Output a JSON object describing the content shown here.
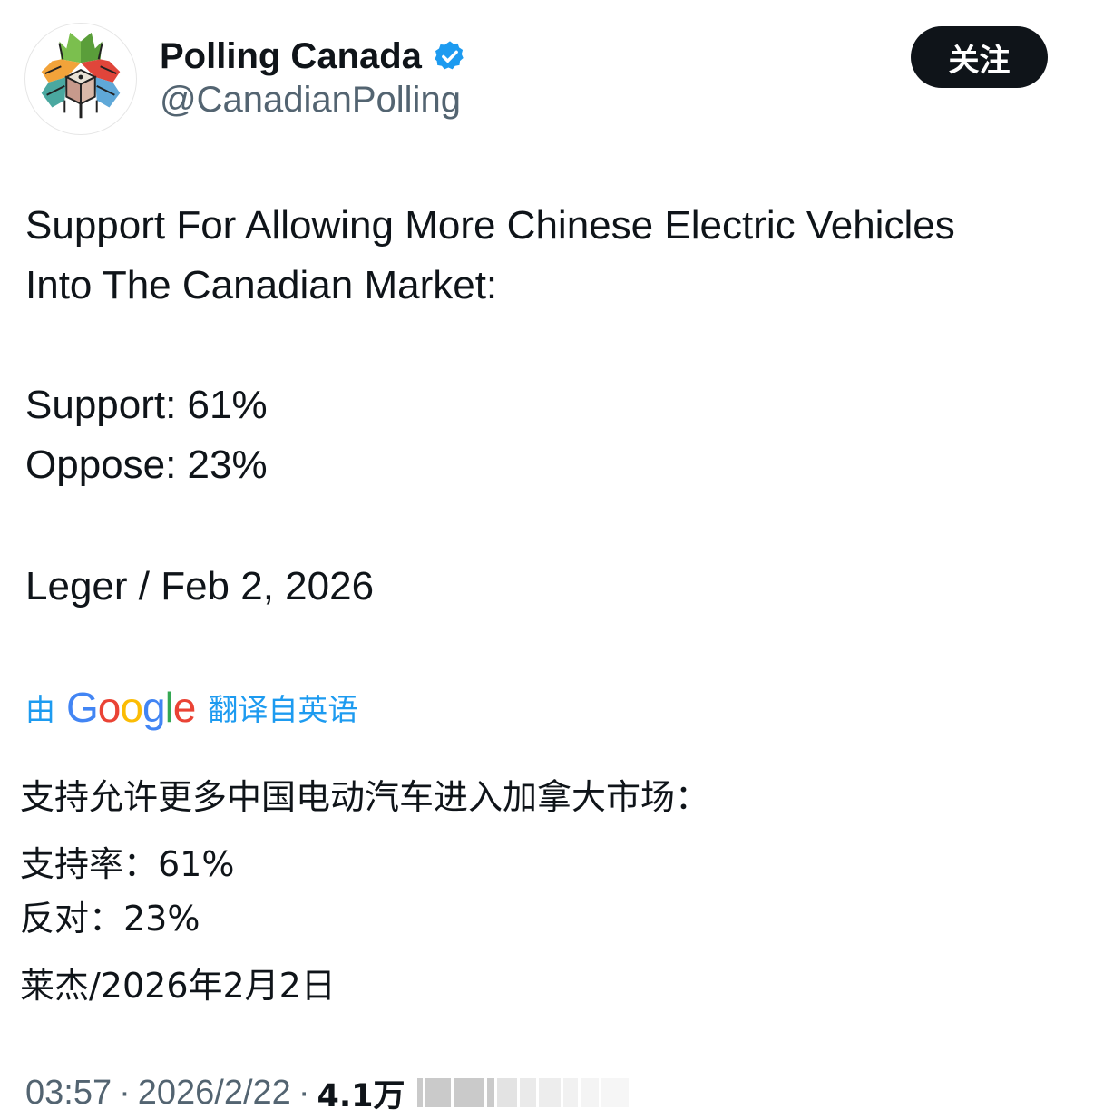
{
  "author": {
    "display_name": "Polling Canada",
    "handle": "@CanadianPolling",
    "verified": true,
    "avatar_icon": "maple-leaf-logo-icon",
    "verified_icon": "verified-badge-icon",
    "verified_color": "#1d9bf0"
  },
  "follow_button": {
    "label": "关注"
  },
  "tweet": {
    "title_line1": "Support For Allowing More Chinese Electric Vehicles",
    "title_line2": "Into The Canadian Market:",
    "support_line": "Support: 61%",
    "oppose_line": "Oppose: 23%",
    "source_line": "Leger / Feb 2, 2026"
  },
  "translation": {
    "prefix": "由",
    "provider": "Google",
    "suffix": "翻译自英语",
    "title": "支持允许更多中国电动汽车进入加拿大市场：",
    "support_line": "支持率：61%",
    "oppose_line": "反对：23%",
    "source_line": "莱杰/2026年2月2日"
  },
  "meta": {
    "time": "03:57",
    "separator": "·",
    "date": "2026/2/22",
    "views": "4.1万"
  },
  "colors": {
    "link_blue": "#1d9bf0",
    "text_primary": "#0f1419",
    "text_secondary": "#536471"
  }
}
